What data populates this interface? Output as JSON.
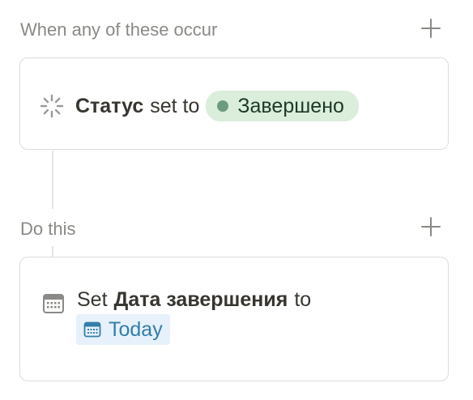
{
  "trigger_section": {
    "title": "When any of these occur",
    "add_icon": "plus-icon",
    "trigger": {
      "icon": "status-spinner-icon",
      "property": "Статус",
      "connector": "set to",
      "value": "Завершено",
      "value_bg": "#dbeddb",
      "value_dot_color": "#6c9b7d"
    }
  },
  "action_section": {
    "title": "Do this",
    "add_icon": "plus-icon",
    "action": {
      "icon": "calendar-icon",
      "verb": "Set",
      "property": "Дата завершения",
      "connector": "to",
      "value": "Today",
      "value_icon": "calendar-icon",
      "value_color": "#337ea9",
      "value_bg": "#e7f1fb"
    }
  }
}
